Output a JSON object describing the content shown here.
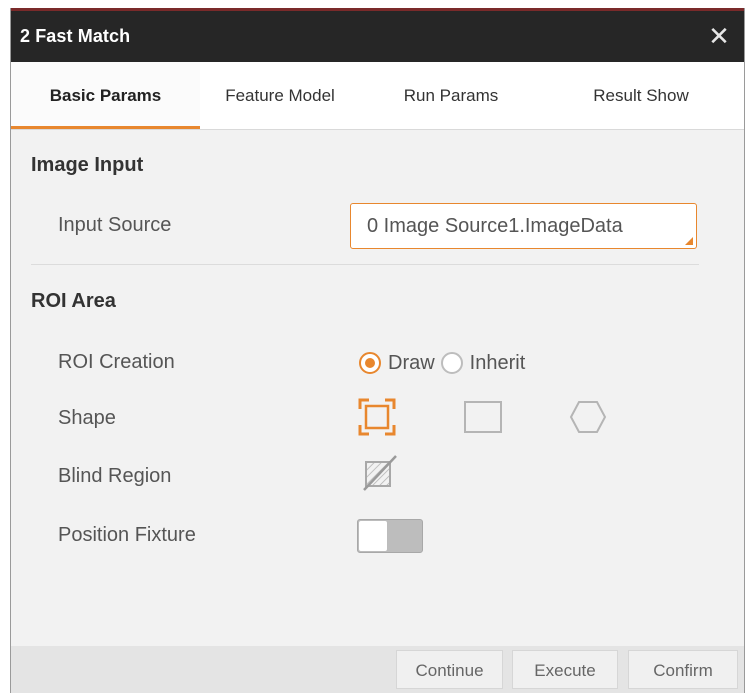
{
  "window": {
    "title": "2 Fast Match",
    "close_icon": "close-icon",
    "accent_color": "#e8872e"
  },
  "tabs": [
    {
      "label": "Basic Params",
      "active": true
    },
    {
      "label": "Feature Model",
      "active": false
    },
    {
      "label": "Run Params",
      "active": false
    },
    {
      "label": "Result Show",
      "active": false
    }
  ],
  "image_input": {
    "section_title": "Image Input",
    "input_source_label": "Input Source",
    "input_source_value": "0 Image Source1.ImageData"
  },
  "roi_area": {
    "section_title": "ROI Area",
    "roi_creation_label": "ROI Creation",
    "roi_creation_options": [
      {
        "label": "Draw",
        "selected": true
      },
      {
        "label": "Inherit",
        "selected": false
      }
    ],
    "shape_label": "Shape",
    "shapes": [
      {
        "icon": "roi-selection-icon",
        "selected": true
      },
      {
        "icon": "rectangle-icon",
        "selected": false
      },
      {
        "icon": "polygon-icon",
        "selected": false
      }
    ],
    "blind_region_label": "Blind Region",
    "blind_region_icon": "blind-region-icon",
    "position_fixture_label": "Position Fixture",
    "position_fixture_on": false
  },
  "footer": {
    "continue_label": "Continue",
    "execute_label": "Execute",
    "confirm_label": "Confirm"
  }
}
